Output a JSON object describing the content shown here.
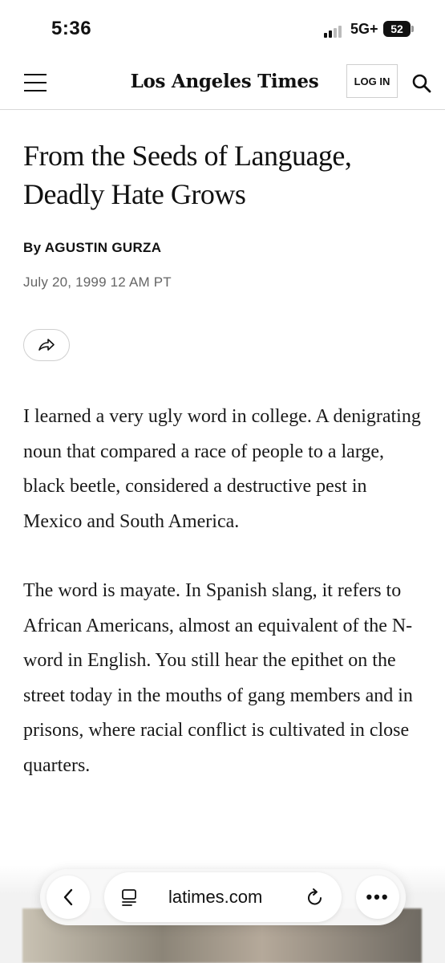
{
  "status_bar": {
    "time": "5:36",
    "network": "5G+",
    "battery": "52"
  },
  "nav": {
    "masthead": "Los Angeles Times",
    "login_label": "LOG IN",
    "menu_icon": "hamburger-menu-icon",
    "search_icon": "search-icon"
  },
  "article": {
    "headline": "From the Seeds of Language, Deadly Hate Grows",
    "byline": "By AGUSTIN GURZA",
    "date": "July 20, 1999 12 AM PT",
    "share_icon": "share-arrow-icon",
    "paragraphs": [
      "I learned a very ugly word in college. A denigrating noun that compared a race of people to a large, black beetle, considered a destructive pest in Mexico and South America.",
      "The word is mayate. In Spanish slang, it refers to African Americans, almost an equivalent of the N-word in English. You still hear the epithet on the street today in the mouths of gang members and in prisons, where racial conflict is cultivated in close quarters."
    ]
  },
  "browser_bar": {
    "url": "latimes.com",
    "back_icon": "chevron-left-icon",
    "reader_icon": "reader-mode-icon",
    "reload_icon": "reload-icon",
    "more_icon": "more-dots-icon",
    "more_label": "•••"
  },
  "colors": {
    "text": "#111111",
    "muted": "#666666",
    "border": "#d9d9d9"
  }
}
